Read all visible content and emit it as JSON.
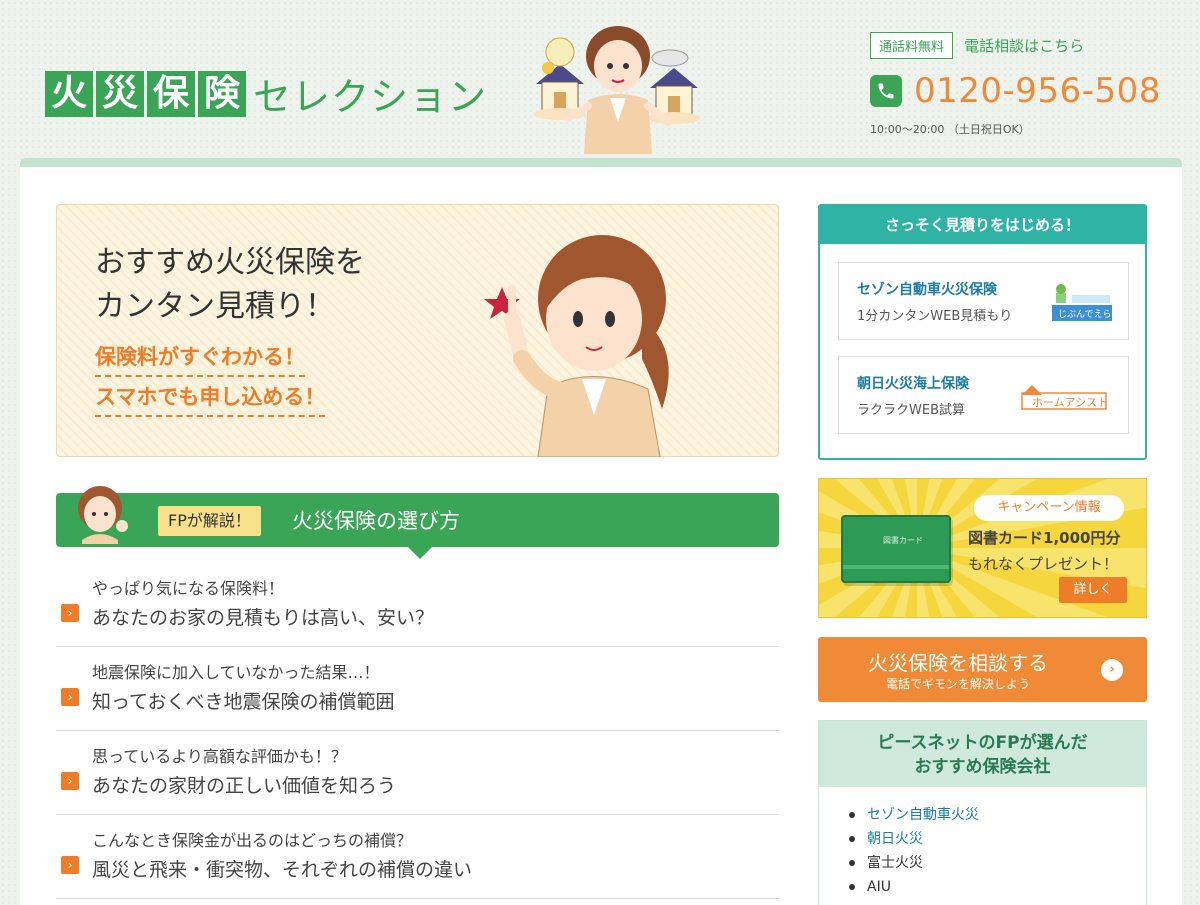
{
  "header": {
    "logo_chars": [
      "火",
      "災",
      "保",
      "険"
    ],
    "logo_rest": "セレクション",
    "free_badge": "通話料無料",
    "consult_text": "電話相談はこちら",
    "phone": "0120-956-508",
    "hours": "10:00〜20:00 （土日祝日OK）"
  },
  "hero": {
    "title_line1": "おすすめ火災保険を",
    "title_line2": "カンタン見積り！",
    "point1": "保険料がすぐわかる！",
    "point2": "スマホでも申し込める！"
  },
  "fp": {
    "badge": "FPが解説！",
    "title": "火災保険の選び方"
  },
  "articles": [
    {
      "sub": "やっぱり気になる保険料！",
      "main": "あなたのお家の見積もりは高い、安い？"
    },
    {
      "sub": "地震保険に加入していなかった結果…！",
      "main": "知っておくべき地震保険の補償範囲"
    },
    {
      "sub": "思っているより高額な評価かも！？",
      "main": "あなたの家財の正しい価値を知ろう"
    },
    {
      "sub": "こんなとき保険金が出るのはどっちの補償？",
      "main": "風災と飛来・衝突物、それぞれの補償の違い"
    }
  ],
  "quote": {
    "header": "さっそく見積りをはじめる！",
    "cards": [
      {
        "name": "セゾン自動車火災保険",
        "desc": "1分カンタンWEB見積もり",
        "logo_text": "じぶんでえらべる火災保険"
      },
      {
        "name": "朝日火災海上保険",
        "desc": "ラクラクWEB試算",
        "logo_text": "ホームアシスト"
      }
    ]
  },
  "campaign": {
    "label": "キャンペーン情報",
    "line1": "図書カード1,000円分",
    "line2": "もれなくプレゼント！",
    "button": "詳しく",
    "card_text": "図書カード"
  },
  "consult": {
    "title": "火災保険を相談する",
    "sub": "電話でギモンを解決しよう"
  },
  "recommend": {
    "title_line1": "ピースネットのFPが選んだ",
    "title_line2": "おすすめ保険会社",
    "items": [
      {
        "label": "セゾン自動車火災",
        "link": true
      },
      {
        "label": "朝日火災",
        "link": true
      },
      {
        "label": "富士火災",
        "link": false
      },
      {
        "label": "AIU",
        "link": false
      }
    ]
  },
  "colors": {
    "brand_green": "#3aa556",
    "accent_orange": "#f08a36",
    "teal": "#2fb3a5",
    "link_blue": "#1b7ca6"
  },
  "icons": {
    "phone": "phone-icon",
    "arrow": "chevron-right-icon",
    "chevron_circle": "chevron-circle-right-icon"
  }
}
